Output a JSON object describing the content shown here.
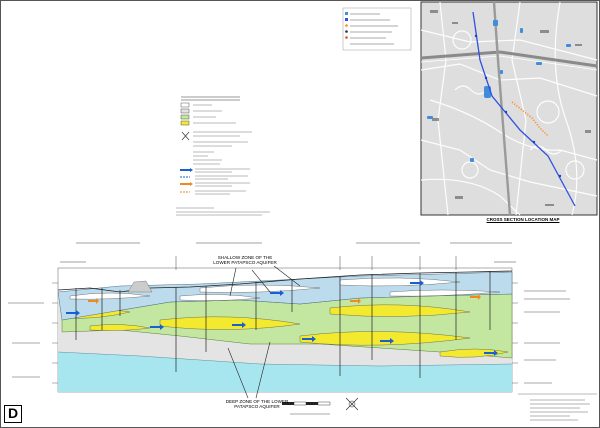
{
  "sheet": {
    "map_title": "CROSS SECTION LOCATION MAP",
    "callout_shallow": "SHALLOW ZONE OF THE LOWER PATAPSCO AQUIFER",
    "callout_deep": "DEEP ZONE OF THE LOWER PATAPSCO AQUIFER",
    "panel_letter": "D"
  },
  "colors": {
    "aquifer_yellow": "#f3e92e",
    "aquifer_green": "#c3e6a1",
    "gray_clay": "#e4e4e4",
    "lower_cyan": "#a8e6ef",
    "upper_blue": "#bcdcee",
    "flow_arrow_blue": "#1a5fd1",
    "flow_arrow_orange": "#f08a1c",
    "map_bg": "#dedede",
    "map_line": "#2f52e0"
  }
}
